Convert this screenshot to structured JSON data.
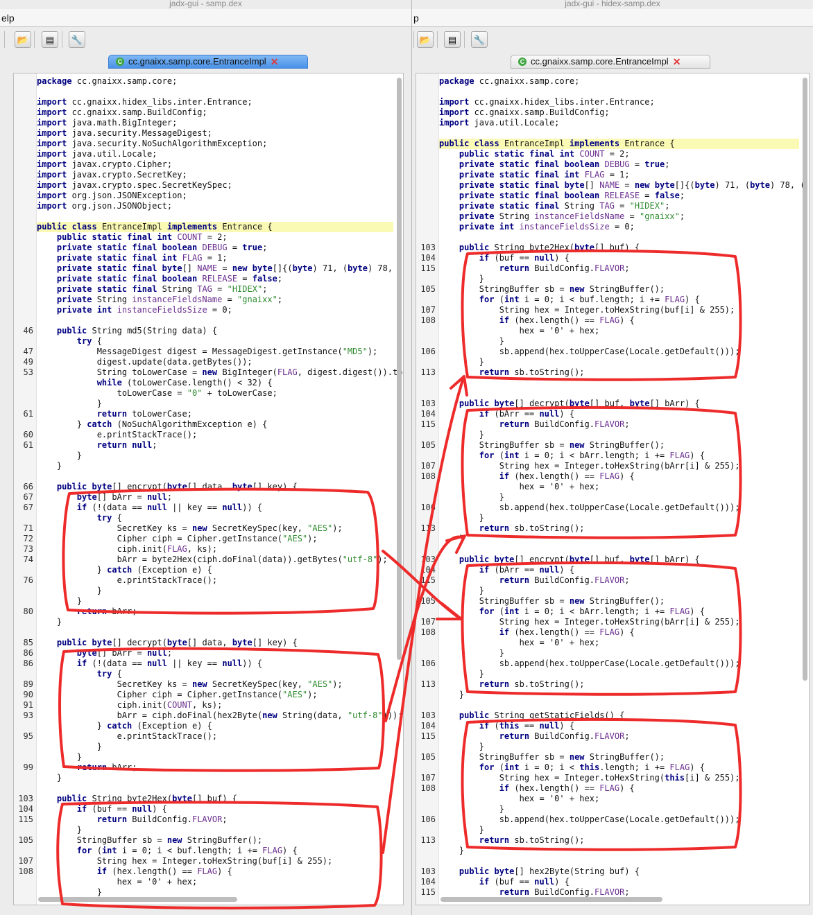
{
  "colors": {
    "annotation_red": "#ee2b2b",
    "keyword_blue": "#000080",
    "field_purple": "#6a2e8e",
    "string_green": "#2e8b2e"
  },
  "left": {
    "title": "jadx-gui - samp.dex",
    "menu_label": "elp",
    "tab_label": "cc.gnaixx.samp.core.EntranceImpl",
    "lines": [
      {
        "n": "",
        "t": "package cc.gnaixx.samp.core;"
      },
      {
        "n": "",
        "t": ""
      },
      {
        "n": "",
        "t": "import cc.gnaixx.hidex_libs.inter.Entrance;"
      },
      {
        "n": "",
        "t": "import cc.gnaixx.samp.BuildConfig;"
      },
      {
        "n": "",
        "t": "import java.math.BigInteger;"
      },
      {
        "n": "",
        "t": "import java.security.MessageDigest;"
      },
      {
        "n": "",
        "t": "import java.security.NoSuchAlgorithmException;"
      },
      {
        "n": "",
        "t": "import java.util.Locale;"
      },
      {
        "n": "",
        "t": "import javax.crypto.Cipher;"
      },
      {
        "n": "",
        "t": "import javax.crypto.SecretKey;"
      },
      {
        "n": "",
        "t": "import javax.crypto.spec.SecretKeySpec;"
      },
      {
        "n": "",
        "t": "import org.json.JSONException;"
      },
      {
        "n": "",
        "t": "import org.json.JSONObject;"
      },
      {
        "n": "",
        "t": ""
      },
      {
        "n": "",
        "t": "public class EntranceImpl implements Entrance {",
        "hl": true
      },
      {
        "n": "",
        "t": "    public static final int COUNT = 2;"
      },
      {
        "n": "",
        "t": "    private static final boolean DEBUG = true;"
      },
      {
        "n": "",
        "t": "    private static final int FLAG = 1;"
      },
      {
        "n": "",
        "t": "    private static final byte[] NAME = new byte[]{(byte) 71, (byte) 78, ("
      },
      {
        "n": "",
        "t": "    private static final boolean RELEASE = false;"
      },
      {
        "n": "",
        "t": "    private static final String TAG = \"HIDEX\";"
      },
      {
        "n": "",
        "t": "    private String instanceFieldsName = \"gnaixx\";"
      },
      {
        "n": "",
        "t": "    private int instanceFieldsSize = 0;"
      },
      {
        "n": "",
        "t": ""
      },
      {
        "n": "46",
        "t": "    public String md5(String data) {"
      },
      {
        "n": "",
        "t": "        try {"
      },
      {
        "n": "47",
        "t": "            MessageDigest digest = MessageDigest.getInstance(\"MD5\");"
      },
      {
        "n": "49",
        "t": "            digest.update(data.getBytes());"
      },
      {
        "n": "53",
        "t": "            String toLowerCase = new BigInteger(FLAG, digest.digest()).to"
      },
      {
        "n": "",
        "t": "            while (toLowerCase.length() < 32) {"
      },
      {
        "n": "",
        "t": "                toLowerCase = \"0\" + toLowerCase;"
      },
      {
        "n": "",
        "t": "            }"
      },
      {
        "n": "61",
        "t": "            return toLowerCase;"
      },
      {
        "n": "",
        "t": "        } catch (NoSuchAlgorithmException e) {"
      },
      {
        "n": "60",
        "t": "            e.printStackTrace();"
      },
      {
        "n": "61",
        "t": "            return null;"
      },
      {
        "n": "",
        "t": "        }"
      },
      {
        "n": "",
        "t": "    }"
      },
      {
        "n": "",
        "t": ""
      },
      {
        "n": "66",
        "t": "    public byte[] encrypt(byte[] data, byte[] key) {"
      },
      {
        "n": "67",
        "t": "        byte[] bArr = null;"
      },
      {
        "n": "67",
        "t": "        if (!(data == null || key == null)) {"
      },
      {
        "n": "",
        "t": "            try {"
      },
      {
        "n": "71",
        "t": "                SecretKey ks = new SecretKeySpec(key, \"AES\");"
      },
      {
        "n": "72",
        "t": "                Cipher ciph = Cipher.getInstance(\"AES\");"
      },
      {
        "n": "73",
        "t": "                ciph.init(FLAG, ks);"
      },
      {
        "n": "74",
        "t": "                bArr = byte2Hex(ciph.doFinal(data)).getBytes(\"utf-8\");"
      },
      {
        "n": "",
        "t": "            } catch (Exception e) {"
      },
      {
        "n": "76",
        "t": "                e.printStackTrace();"
      },
      {
        "n": "",
        "t": "            }"
      },
      {
        "n": "",
        "t": "        }"
      },
      {
        "n": "80",
        "t": "        return bArr;"
      },
      {
        "n": "",
        "t": "    }"
      },
      {
        "n": "",
        "t": ""
      },
      {
        "n": "85",
        "t": "    public byte[] decrypt(byte[] data, byte[] key) {"
      },
      {
        "n": "86",
        "t": "        byte[] bArr = null;"
      },
      {
        "n": "86",
        "t": "        if (!(data == null || key == null)) {"
      },
      {
        "n": "",
        "t": "            try {"
      },
      {
        "n": "89",
        "t": "                SecretKey ks = new SecretKeySpec(key, \"AES\");"
      },
      {
        "n": "90",
        "t": "                Cipher ciph = Cipher.getInstance(\"AES\");"
      },
      {
        "n": "91",
        "t": "                ciph.init(COUNT, ks);"
      },
      {
        "n": "93",
        "t": "                bArr = ciph.doFinal(hex2Byte(new String(data, \"utf-8\")));"
      },
      {
        "n": "",
        "t": "            } catch (Exception e) {"
      },
      {
        "n": "95",
        "t": "                e.printStackTrace();"
      },
      {
        "n": "",
        "t": "            }"
      },
      {
        "n": "",
        "t": "        }"
      },
      {
        "n": "99",
        "t": "        return bArr;"
      },
      {
        "n": "",
        "t": "    }"
      },
      {
        "n": "",
        "t": ""
      },
      {
        "n": "103",
        "t": "    public String byte2Hex(byte[] buf) {"
      },
      {
        "n": "104",
        "t": "        if (buf == null) {"
      },
      {
        "n": "115",
        "t": "            return BuildConfig.FLAVOR;"
      },
      {
        "n": "",
        "t": "        }"
      },
      {
        "n": "105",
        "t": "        StringBuffer sb = new StringBuffer();"
      },
      {
        "n": "",
        "t": "        for (int i = 0; i < buf.length; i += FLAG) {"
      },
      {
        "n": "107",
        "t": "            String hex = Integer.toHexString(buf[i] & 255);"
      },
      {
        "n": "108",
        "t": "            if (hex.length() == FLAG) {"
      },
      {
        "n": "",
        "t": "                hex = '0' + hex;"
      },
      {
        "n": "",
        "t": "            }"
      }
    ]
  },
  "right": {
    "title": "jadx-gui - hidex-samp.dex",
    "menu_label": "p",
    "tab_label": "cc.gnaixx.samp.core.EntranceImpl",
    "lines": [
      {
        "n": "",
        "t": "package cc.gnaixx.samp.core;"
      },
      {
        "n": "",
        "t": ""
      },
      {
        "n": "",
        "t": "import cc.gnaixx.hidex_libs.inter.Entrance;"
      },
      {
        "n": "",
        "t": "import cc.gnaixx.samp.BuildConfig;"
      },
      {
        "n": "",
        "t": "import java.util.Locale;"
      },
      {
        "n": "",
        "t": ""
      },
      {
        "n": "",
        "t": "public class EntranceImpl implements Entrance {",
        "hl": true
      },
      {
        "n": "",
        "t": "    public static final int COUNT = 2;"
      },
      {
        "n": "",
        "t": "    private static final boolean DEBUG = true;"
      },
      {
        "n": "",
        "t": "    private static final int FLAG = 1;"
      },
      {
        "n": "",
        "t": "    private static final byte[] NAME = new byte[]{(byte) 71, (byte) 78, ("
      },
      {
        "n": "",
        "t": "    private static final boolean RELEASE = false;"
      },
      {
        "n": "",
        "t": "    private static final String TAG = \"HIDEX\";"
      },
      {
        "n": "",
        "t": "    private String instanceFieldsName = \"gnaixx\";"
      },
      {
        "n": "",
        "t": "    private int instanceFieldsSize = 0;"
      },
      {
        "n": "",
        "t": ""
      },
      {
        "n": "103",
        "t": "    public String byte2Hex(byte[] buf) {"
      },
      {
        "n": "104",
        "t": "        if (buf == null) {"
      },
      {
        "n": "115",
        "t": "            return BuildConfig.FLAVOR;"
      },
      {
        "n": "",
        "t": "        }"
      },
      {
        "n": "105",
        "t": "        StringBuffer sb = new StringBuffer();"
      },
      {
        "n": "",
        "t": "        for (int i = 0; i < buf.length; i += FLAG) {"
      },
      {
        "n": "107",
        "t": "            String hex = Integer.toHexString(buf[i] & 255);"
      },
      {
        "n": "108",
        "t": "            if (hex.length() == FLAG) {"
      },
      {
        "n": "",
        "t": "                hex = '0' + hex;"
      },
      {
        "n": "",
        "t": "            }"
      },
      {
        "n": "106",
        "t": "            sb.append(hex.toUpperCase(Locale.getDefault()));"
      },
      {
        "n": "",
        "t": "        }"
      },
      {
        "n": "113",
        "t": "        return sb.toString();"
      },
      {
        "n": "",
        "t": "    }"
      },
      {
        "n": "",
        "t": ""
      },
      {
        "n": "103",
        "t": "    public byte[] decrypt(byte[] buf, byte[] bArr) {"
      },
      {
        "n": "104",
        "t": "        if (bArr == null) {"
      },
      {
        "n": "115",
        "t": "            return BuildConfig.FLAVOR;"
      },
      {
        "n": "",
        "t": "        }"
      },
      {
        "n": "105",
        "t": "        StringBuffer sb = new StringBuffer();"
      },
      {
        "n": "",
        "t": "        for (int i = 0; i < bArr.length; i += FLAG) {"
      },
      {
        "n": "107",
        "t": "            String hex = Integer.toHexString(bArr[i] & 255);"
      },
      {
        "n": "108",
        "t": "            if (hex.length() == FLAG) {"
      },
      {
        "n": "",
        "t": "                hex = '0' + hex;"
      },
      {
        "n": "",
        "t": "            }"
      },
      {
        "n": "106",
        "t": "            sb.append(hex.toUpperCase(Locale.getDefault()));"
      },
      {
        "n": "",
        "t": "        }"
      },
      {
        "n": "113",
        "t": "        return sb.toString();"
      },
      {
        "n": "",
        "t": "    }"
      },
      {
        "n": "",
        "t": ""
      },
      {
        "n": "103",
        "t": "    public byte[] encrypt(byte[] buf, byte[] bArr) {"
      },
      {
        "n": "104",
        "t": "        if (bArr == null) {"
      },
      {
        "n": "115",
        "t": "            return BuildConfig.FLAVOR;"
      },
      {
        "n": "",
        "t": "        }"
      },
      {
        "n": "105",
        "t": "        StringBuffer sb = new StringBuffer();"
      },
      {
        "n": "",
        "t": "        for (int i = 0; i < bArr.length; i += FLAG) {"
      },
      {
        "n": "107",
        "t": "            String hex = Integer.toHexString(bArr[i] & 255);"
      },
      {
        "n": "108",
        "t": "            if (hex.length() == FLAG) {"
      },
      {
        "n": "",
        "t": "                hex = '0' + hex;"
      },
      {
        "n": "",
        "t": "            }"
      },
      {
        "n": "106",
        "t": "            sb.append(hex.toUpperCase(Locale.getDefault()));"
      },
      {
        "n": "",
        "t": "        }"
      },
      {
        "n": "113",
        "t": "        return sb.toString();"
      },
      {
        "n": "",
        "t": "    }"
      },
      {
        "n": "",
        "t": ""
      },
      {
        "n": "103",
        "t": "    public String getStaticFields() {"
      },
      {
        "n": "104",
        "t": "        if (this == null) {"
      },
      {
        "n": "115",
        "t": "            return BuildConfig.FLAVOR;"
      },
      {
        "n": "",
        "t": "        }"
      },
      {
        "n": "105",
        "t": "        StringBuffer sb = new StringBuffer();"
      },
      {
        "n": "",
        "t": "        for (int i = 0; i < this.length; i += FLAG) {"
      },
      {
        "n": "107",
        "t": "            String hex = Integer.toHexString(this[i] & 255);"
      },
      {
        "n": "108",
        "t": "            if (hex.length() == FLAG) {"
      },
      {
        "n": "",
        "t": "                hex = '0' + hex;"
      },
      {
        "n": "",
        "t": "            }"
      },
      {
        "n": "106",
        "t": "            sb.append(hex.toUpperCase(Locale.getDefault()));"
      },
      {
        "n": "",
        "t": "        }"
      },
      {
        "n": "113",
        "t": "        return sb.toString();"
      },
      {
        "n": "",
        "t": "    }"
      },
      {
        "n": "",
        "t": ""
      },
      {
        "n": "103",
        "t": "    public byte[] hex2Byte(String buf) {"
      },
      {
        "n": "104",
        "t": "        if (buf == null) {"
      },
      {
        "n": "115",
        "t": "            return BuildConfig.FLAVOR;"
      }
    ]
  }
}
